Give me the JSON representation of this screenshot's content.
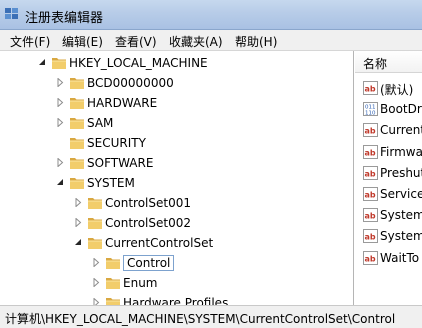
{
  "window": {
    "title": "注册表编辑器"
  },
  "menu": {
    "items": [
      "文件(F)",
      "编辑(E)",
      "查看(V)",
      "收藏夹(A)",
      "帮助(H)"
    ]
  },
  "tree": {
    "nodes": [
      {
        "label": "HKEY_LOCAL_MACHINE",
        "state": "expanded"
      },
      {
        "label": "BCD00000000",
        "state": "collapsed"
      },
      {
        "label": "HARDWARE",
        "state": "collapsed"
      },
      {
        "label": "SAM",
        "state": "collapsed"
      },
      {
        "label": "SECURITY",
        "state": "none"
      },
      {
        "label": "SOFTWARE",
        "state": "collapsed"
      },
      {
        "label": "SYSTEM",
        "state": "expanded"
      },
      {
        "label": "ControlSet001",
        "state": "collapsed"
      },
      {
        "label": "ControlSet002",
        "state": "collapsed"
      },
      {
        "label": "CurrentControlSet",
        "state": "expanded"
      },
      {
        "label": "Control",
        "state": "collapsed",
        "selected": true
      },
      {
        "label": "Enum",
        "state": "collapsed"
      },
      {
        "label": "Hardware Profiles",
        "state": "collapsed"
      }
    ]
  },
  "values": {
    "column_name": "名称",
    "items": [
      {
        "name": "(默认)",
        "icon": "string-value-icon"
      },
      {
        "name": "BootDr",
        "icon": "binary-value-icon"
      },
      {
        "name": "Current",
        "icon": "string-value-icon"
      },
      {
        "name": "Firmwa",
        "icon": "string-value-icon"
      },
      {
        "name": "Preshut",
        "icon": "string-value-icon"
      },
      {
        "name": "Service",
        "icon": "string-value-icon"
      },
      {
        "name": "System",
        "icon": "string-value-icon"
      },
      {
        "name": "System",
        "icon": "string-value-icon"
      },
      {
        "name": "WaitTo",
        "icon": "string-value-icon"
      }
    ]
  },
  "status": {
    "path": "计算机\\HKEY_LOCAL_MACHINE\\SYSTEM\\CurrentControlSet\\Control"
  }
}
